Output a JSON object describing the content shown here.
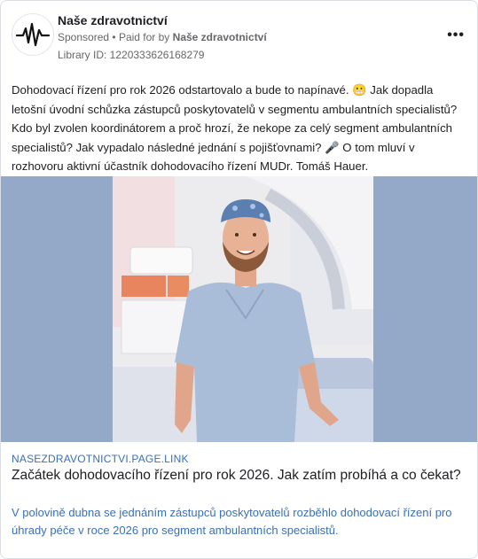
{
  "post": {
    "page_name": "Naše zdravotnictví",
    "sponsored": "Sponsored",
    "paid_for_prefix": "Paid for by",
    "paid_for_name": "Naše zdravotnictví",
    "library_id": "Library ID: 1220333626168279",
    "more_label": "•••",
    "text_1": "Dohodovací řízení pro rok 2026 odstartovalo a bude to napínavé.",
    "emoji_1": "😬",
    "text_2": "Jak dopadla letošní úvodní schůzka zástupců poskytovatelů v segmentu ambulantních specialistů? Kdo byl zvolen koordinátorem a proč hrozí, že nekope za celý segment ambulantních specialistů? Jak vypadalo následné jednání s pojišťovnami?",
    "emoji_2": "🎤",
    "text_3": "O tom mluví v rozhovoru aktivní účastník dohodovacího řízení MUDr. Tomáš Hauer."
  },
  "link": {
    "domain": "NASEZDRAVOTNICTVI.PAGE.LINK",
    "title": "Začátek dohodovacího řízení pro rok 2026. Jak zatím probíhá a co čekat?",
    "description": "V polovině dubna se jednáním zástupců poskytovatelů rozběhlo dohodovací řízení pro úhrady péče v roce 2026 pro segment ambulantních specialistů."
  },
  "colors": {
    "image_side_background": "#94a9c8",
    "link_blue": "#3b6fb6",
    "scrubs": "#a9bcd8"
  },
  "icons": {
    "avatar": "heartbeat-logo",
    "more": "more-options-icon"
  }
}
